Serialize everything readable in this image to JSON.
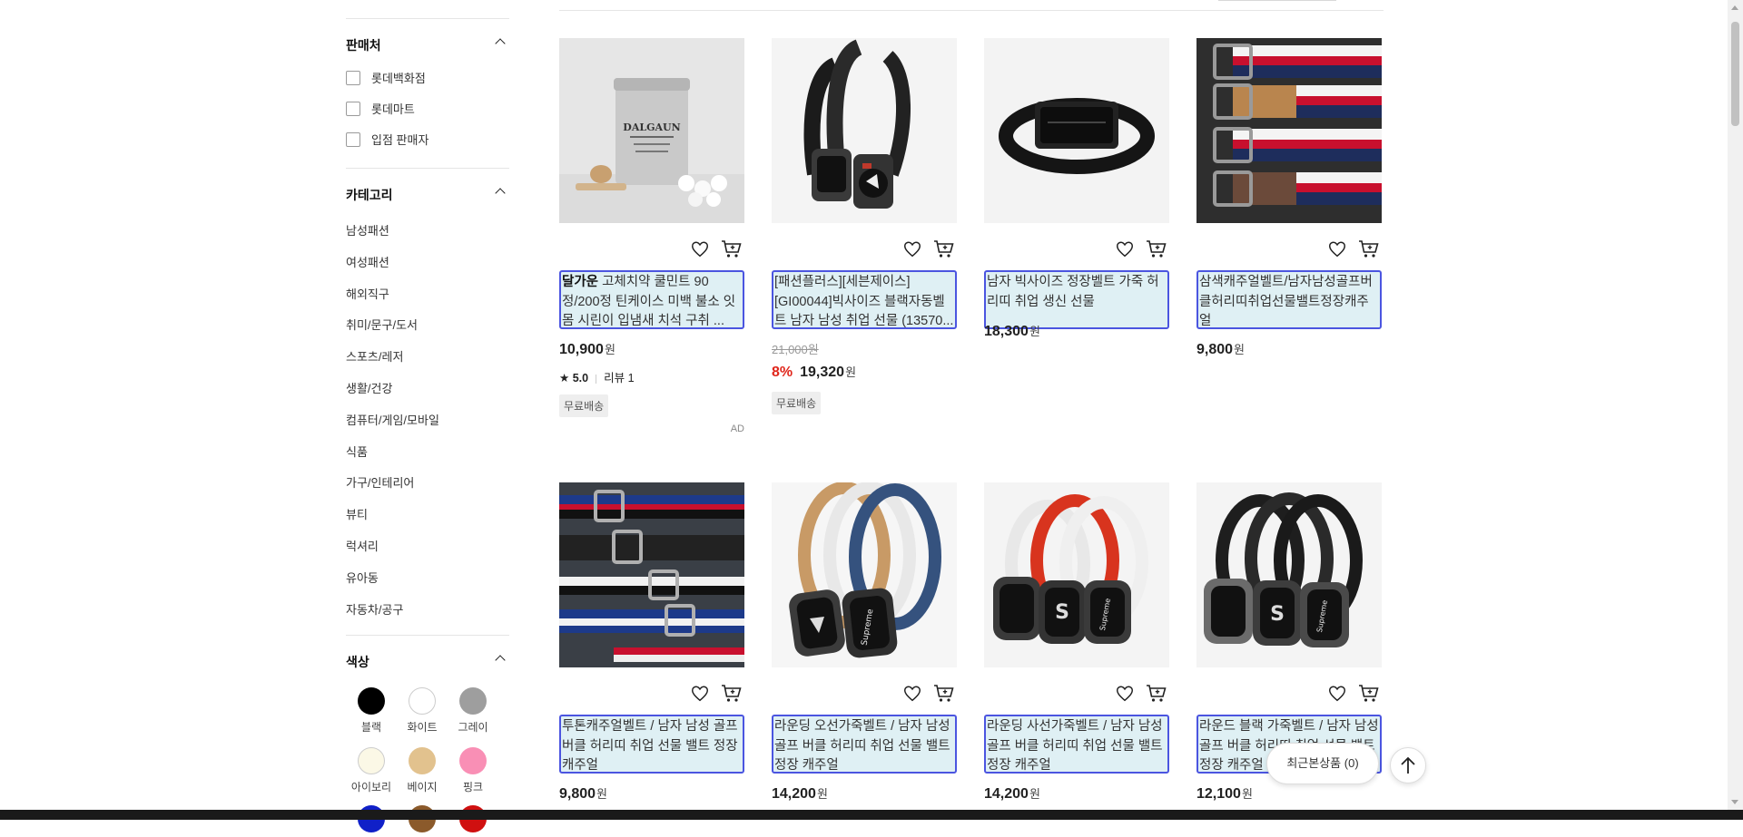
{
  "filters": {
    "seller": {
      "title": "판매처",
      "options": [
        "롯데백화점",
        "롯데마트",
        "입점 판매자"
      ]
    },
    "category": {
      "title": "카테고리",
      "items": [
        "남성패션",
        "여성패션",
        "해외직구",
        "취미/문구/도서",
        "스포츠/레저",
        "생활/건강",
        "컴퓨터/게임/모바일",
        "식품",
        "가구/인테리어",
        "뷰티",
        "럭셔리",
        "유아동",
        "자동차/공구"
      ]
    },
    "color": {
      "title": "색상",
      "swatches": [
        {
          "label": "블랙",
          "hex": "#000000"
        },
        {
          "label": "화이트",
          "hex": "#ffffff"
        },
        {
          "label": "그레이",
          "hex": "#9e9e9e"
        },
        {
          "label": "아이보리",
          "hex": "#fbf8e6"
        },
        {
          "label": "베이지",
          "hex": "#e2c28e"
        },
        {
          "label": "핑크",
          "hex": "#f98fb5"
        },
        {
          "label": "",
          "hex": "#1020c8"
        },
        {
          "label": "",
          "hex": "#8b5a2b"
        },
        {
          "label": "",
          "hex": "#d01010"
        }
      ]
    }
  },
  "products": [
    {
      "brand": "달가운",
      "title": "고체치약 쿨민트 90정/200정 틴케이스 미백 불소 잇몸 시린이 입냄새 치석 구취 ...",
      "price": "10,900",
      "currency": "원",
      "rating": "5.0",
      "reviews": "리뷰 1",
      "badge": "무료배송",
      "ad": "AD"
    },
    {
      "title": "[패션플러스][세븐제이스][GI00044]빅사이즈 블랙자동벨트 남자 남성 취업 선물 (13570...",
      "original_price": "21,000원",
      "discount": "8%",
      "price": "19,320",
      "currency": "원",
      "badge": "무료배송"
    },
    {
      "title": "남자 빅사이즈 정장벨트 가죽 허리띠 취업 생신 선물",
      "price": "18,300",
      "currency": "원"
    },
    {
      "title": "삼색캐주얼벨트/남자남성골프버클허리띠취업선물밸트정장캐주얼",
      "price": "9,800",
      "currency": "원"
    },
    {
      "title": "투톤캐주얼벨트 / 남자 남성 골프 버클 허리띠 취업 선물 밸트 정장 캐주얼",
      "price": "9,800",
      "currency": "원"
    },
    {
      "title": "라운딩 오선가죽벨트 / 남자 남성 골프 버클 허리띠 취업 선물 밸트 정장 캐주얼",
      "price": "14,200",
      "currency": "원"
    },
    {
      "title": "라운딩 사선가죽벨트 / 남자 남성 골프 버클 허리띠 취업 선물 밸트 정장 캐주얼",
      "price": "14,200",
      "currency": "원"
    },
    {
      "title": "라운드 블랙 가죽벨트 / 남자 남성 골프 버클 허리띠 취업 선물 밸트 정장 캐주얼",
      "price": "12,100",
      "currency": "원"
    }
  ],
  "floating": {
    "recent_label": "최근본상품 (0)"
  }
}
